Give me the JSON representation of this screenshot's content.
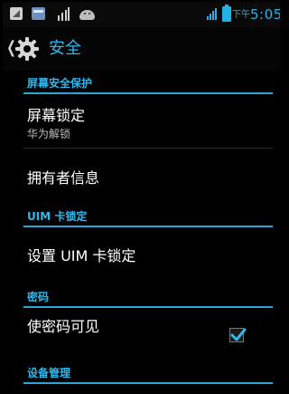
{
  "status_bar": {
    "time_prefix": "下午",
    "time": "5:05",
    "icons": [
      "usb-debug-icon",
      "store-notification-icon",
      "sim-card-icon",
      "android-icon",
      "signal-icon",
      "battery-icon"
    ]
  },
  "action_bar": {
    "title": "安全",
    "icon": "gear-icon"
  },
  "sections": {
    "screen_security": {
      "header": "屏幕安全保护",
      "screen_lock_title": "屏幕锁定",
      "screen_lock_summary": "华为解锁",
      "owner_info_title": "拥有者信息"
    },
    "uim_lock": {
      "header": "UIM 卡锁定",
      "setup_title": "设置 UIM 卡锁定"
    },
    "passwords": {
      "header": "密码",
      "show_password_title": "使密码可见",
      "show_password_checked": true
    },
    "device_admin": {
      "header": "设备管理"
    }
  },
  "colors": {
    "accent": "#2fb8ee",
    "background": "#000000",
    "text": "#ffffff",
    "summary_text": "#bdbdbd"
  }
}
